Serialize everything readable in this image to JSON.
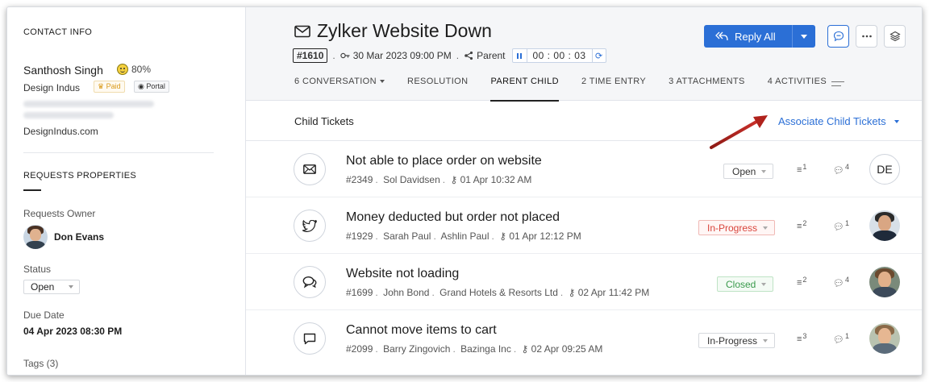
{
  "sidebar": {
    "contact_info_title": "CONTACT INFO",
    "contact_name": "Santhosh Singh",
    "happiness": "80%",
    "company": "Design Indus",
    "tag_paid": "Paid",
    "tag_portal": "Portal",
    "website": "DesignIndus.com",
    "requests_properties_title": "REQUESTS PROPERTIES",
    "owner_label": "Requests Owner",
    "owner_name": "Don Evans",
    "status_label": "Status",
    "status_value": "Open",
    "due_label": "Due Date",
    "due_value": "04 Apr 2023 08:30 PM",
    "tags_label": "Tags (3)"
  },
  "ticket": {
    "title": "Zylker Website Down",
    "id": "#1610",
    "created": "30 Mar 2023 09:00 PM",
    "type": "Parent",
    "timer": "00 : 00 : 03"
  },
  "actions": {
    "reply_all": "Reply All"
  },
  "tabs": [
    {
      "label": "6 CONVERSATION"
    },
    {
      "label": "RESOLUTION"
    },
    {
      "label": "PARENT CHILD"
    },
    {
      "label": "2 TIME ENTRY"
    },
    {
      "label": "3 ATTACHMENTS"
    },
    {
      "label": "4 ACTIVITIES"
    }
  ],
  "child_section": {
    "title": "Child Tickets",
    "associate": "Associate Child Tickets"
  },
  "child_tickets": [
    {
      "channel": "email-icon",
      "subject": "Not able to place order on website",
      "id": "#2349",
      "contact": "Sol Davidsen",
      "account": "",
      "date": "01 Apr 10:32 AM",
      "status": "Open",
      "status_color": "#333333",
      "tasks": "1",
      "comments": "4",
      "assignee": "DE"
    },
    {
      "channel": "twitter-icon",
      "subject": "Money deducted but order not placed",
      "id": "#1929",
      "contact": "Sarah Paul",
      "account": "Ashlin Paul",
      "date": "01 Apr 12:12  PM",
      "status": "In-Progress",
      "status_color": "#d9443b",
      "tasks": "2",
      "comments": "1",
      "assignee": ""
    },
    {
      "channel": "chat-icon",
      "subject": "Website not loading",
      "id": "#1699",
      "contact": "John Bond",
      "account": "Grand Hotels & Resorts Ltd",
      "date": "02 Apr 11:42  PM",
      "status": "Closed",
      "status_color": "#3a9a4c",
      "tasks": "2",
      "comments": "4",
      "assignee": ""
    },
    {
      "channel": "message-icon",
      "subject": "Cannot move items to cart",
      "id": "#2099",
      "contact": "Barry Zingovich",
      "account": "Bazinga Inc",
      "date": "02 Apr 09:25  AM",
      "status": "In-Progress",
      "status_color": "#333333",
      "tasks": "3",
      "comments": "1",
      "assignee": ""
    }
  ],
  "colors": {
    "accent": "#2b6fd6",
    "annotation_arrow": "#b0221c"
  }
}
